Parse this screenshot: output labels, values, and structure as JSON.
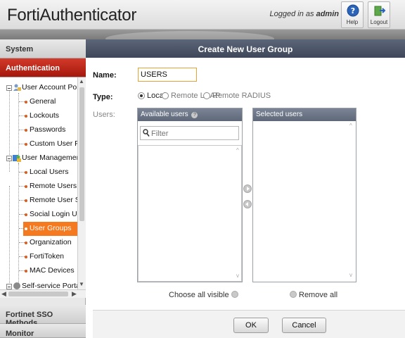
{
  "header": {
    "brand": "FortiAuthenticator",
    "login_prefix": "Logged in as ",
    "login_user": "admin",
    "help_label": "Help",
    "logout_label": "Logout"
  },
  "nav": {
    "system": "System",
    "authentication": "Authentication",
    "fsso": "Fortinet SSO Methods",
    "monitor": "Monitor",
    "tree": {
      "user_account_policies": "User Account Policies",
      "general": "General",
      "lockouts": "Lockouts",
      "passwords": "Passwords",
      "custom_user_fields": "Custom User Fields",
      "user_management": "User Management",
      "local_users": "Local Users",
      "remote_users": "Remote Users",
      "remote_user_sync_rules": "Remote User Sync Rules",
      "social_login_users": "Social Login Users",
      "user_groups": "User Groups",
      "organization": "Organization",
      "fortitoken": "FortiToken",
      "mac_devices": "MAC Devices",
      "self_service_portal": "Self-service Portal"
    }
  },
  "form": {
    "title": "Create New User Group",
    "name_label": "Name:",
    "name_value": "USERS",
    "type_label": "Type:",
    "type_options": [
      "Local",
      "Remote LDAP",
      "Remote RADIUS"
    ],
    "type_selected": "Local",
    "users_label": "Users:",
    "available_users": "Available users",
    "selected_users": "Selected users",
    "filter_placeholder": "Filter",
    "choose_all_visible": "Choose all visible",
    "remove_all": "Remove all",
    "ok": "OK",
    "cancel": "Cancel"
  },
  "colors": {
    "accent_red": "#c0281a",
    "selection_orange": "#f5791f",
    "titlebar": "#4b5466"
  }
}
